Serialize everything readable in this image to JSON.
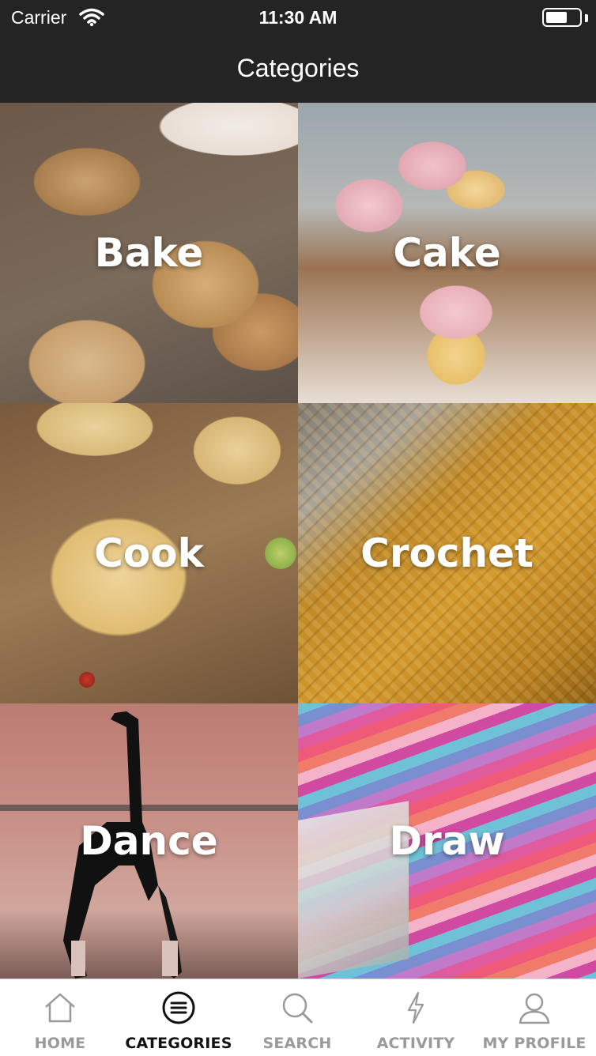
{
  "status_bar": {
    "carrier": "Carrier",
    "time": "11:30 AM",
    "icons": [
      "wifi-icon",
      "battery-icon"
    ]
  },
  "nav": {
    "title": "Categories"
  },
  "categories": [
    {
      "label": "Bake"
    },
    {
      "label": "Cake"
    },
    {
      "label": "Cook"
    },
    {
      "label": "Crochet"
    },
    {
      "label": "Dance"
    },
    {
      "label": "Draw"
    }
  ],
  "tab_bar": {
    "active_index": 1,
    "tabs": [
      {
        "label": "HOME",
        "icon": "home-icon"
      },
      {
        "label": "CATEGORIES",
        "icon": "categories-icon"
      },
      {
        "label": "SEARCH",
        "icon": "search-icon"
      },
      {
        "label": "ACTIVITY",
        "icon": "activity-icon"
      },
      {
        "label": "MY PROFILE",
        "icon": "profile-icon"
      }
    ]
  },
  "colors": {
    "header_background": "#242424",
    "tab_active": "#111111",
    "tab_inactive": "#9a9a9a"
  }
}
